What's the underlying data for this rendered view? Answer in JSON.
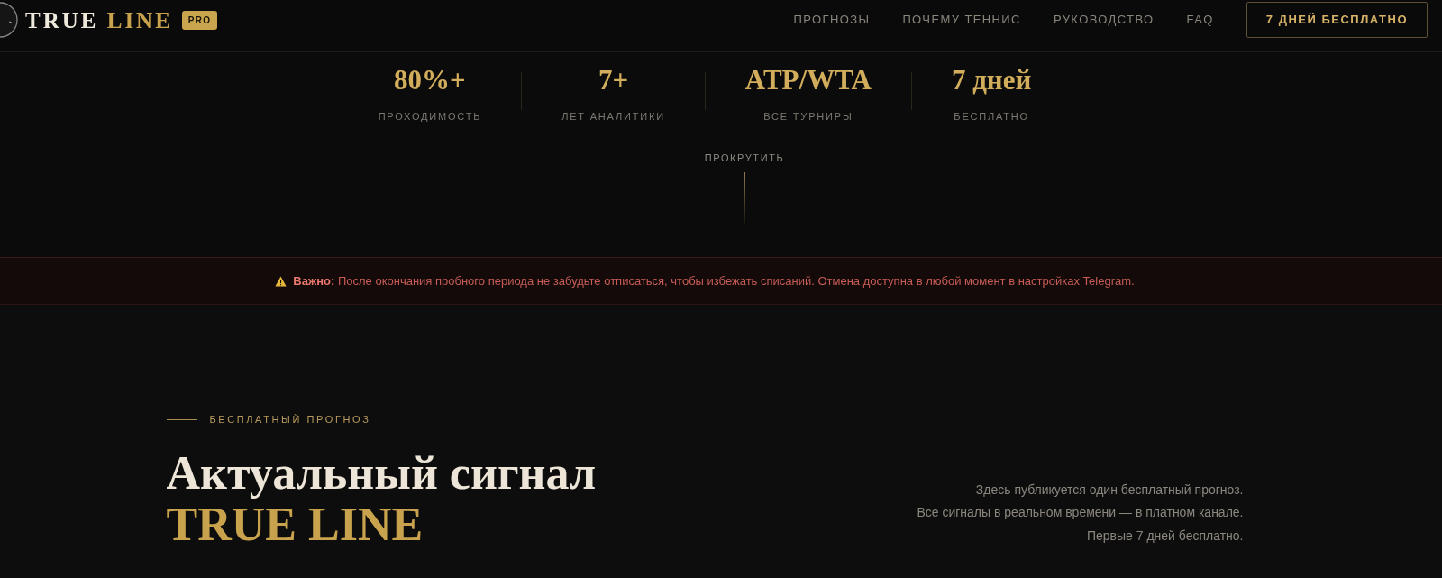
{
  "header": {
    "logo": {
      "primary": "TRUE",
      "accent": "LINE",
      "badge": "PRO"
    },
    "nav": [
      {
        "label": "ПРОГНОЗЫ"
      },
      {
        "label": "ПОЧЕМУ ТЕННИС"
      },
      {
        "label": "РУКОВОДСТВО"
      },
      {
        "label": "FAQ"
      }
    ],
    "cta_button": "7 ДНЕЙ БЕСПЛАТНО"
  },
  "stats": [
    {
      "value": "80%+",
      "label": "ПРОХОДИМОСТЬ"
    },
    {
      "value": "7+",
      "label": "ЛЕТ АНАЛИТИКИ"
    },
    {
      "value": "ATP/WTA",
      "label": "ВСЕ ТУРНИРЫ"
    },
    {
      "value": "7 дней",
      "label": "БЕСПЛАТНО"
    }
  ],
  "scroll_hint": "ПРОКРУТИТЬ",
  "notice": {
    "text": "**Важно:** После окончания пробного периода не забудьте отписаться, чтобы избежать списаний. Отмена доступна в любой момент в настройках Telegram."
  },
  "free_forecast": {
    "eyebrow": "БЕСПЛАТНЫЙ ПРОГНОЗ",
    "title": [
      "Актуальный сигнал",
      "TRUE LINE"
    ],
    "description": [
      "Здесь публикуется один бесплатный прогноз.",
      "Все сигналы в реальном времени — в платном канале.",
      "Первые 7 дней бесплатно."
    ]
  }
}
